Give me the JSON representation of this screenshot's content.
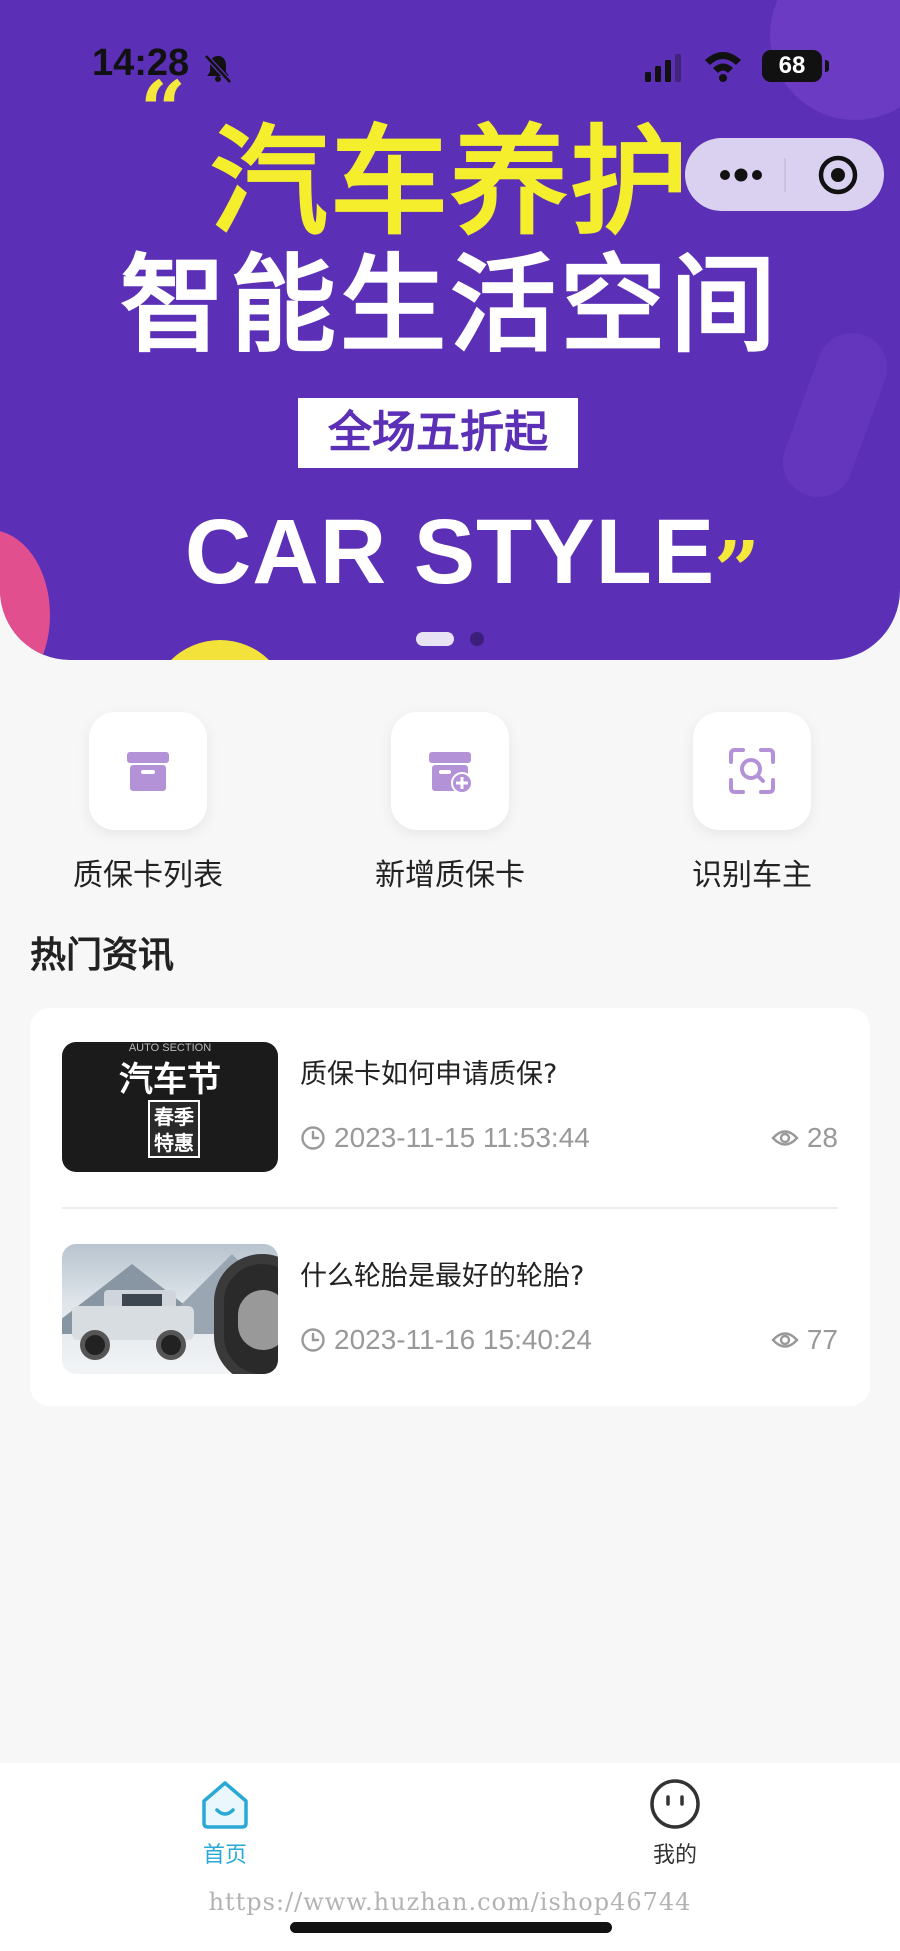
{
  "status_bar": {
    "time": "14:28",
    "battery": "68"
  },
  "banner": {
    "quote_open": "“",
    "quote_close": "”",
    "headline": "汽车养护",
    "subhead": "智能生活空间",
    "promo": "全场五折起",
    "tagline": "CAR STYLE",
    "slides_total": 2,
    "slide_active": 1,
    "colors": {
      "background": "#5b2fb6",
      "headline": "#f4ee2d"
    }
  },
  "quick_actions": [
    {
      "label": "质保卡列表",
      "icon": "card-box-icon"
    },
    {
      "label": "新增质保卡",
      "icon": "add-card-icon"
    },
    {
      "label": "识别车主",
      "icon": "scan-icon"
    }
  ],
  "news": {
    "section_title": "热门资讯",
    "items": [
      {
        "title": "质保卡如何申请质保?",
        "date": "2023-11-15 11:53:44",
        "views": "28",
        "thumb": {
          "top": "AUTO SECTION",
          "main": "汽车节",
          "box_line1": "春季",
          "box_line2": "特惠"
        }
      },
      {
        "title": "什么轮胎是最好的轮胎?",
        "date": "2023-11-16 15:40:24",
        "views": "77"
      }
    ]
  },
  "tabbar": {
    "items": [
      {
        "label": "首页",
        "icon": "home-icon",
        "active": true
      },
      {
        "label": "我的",
        "icon": "smiley-icon",
        "active": false
      }
    ],
    "active_color": "#2aa9d6"
  },
  "watermark": "https://www.huzhan.com/ishop46744"
}
